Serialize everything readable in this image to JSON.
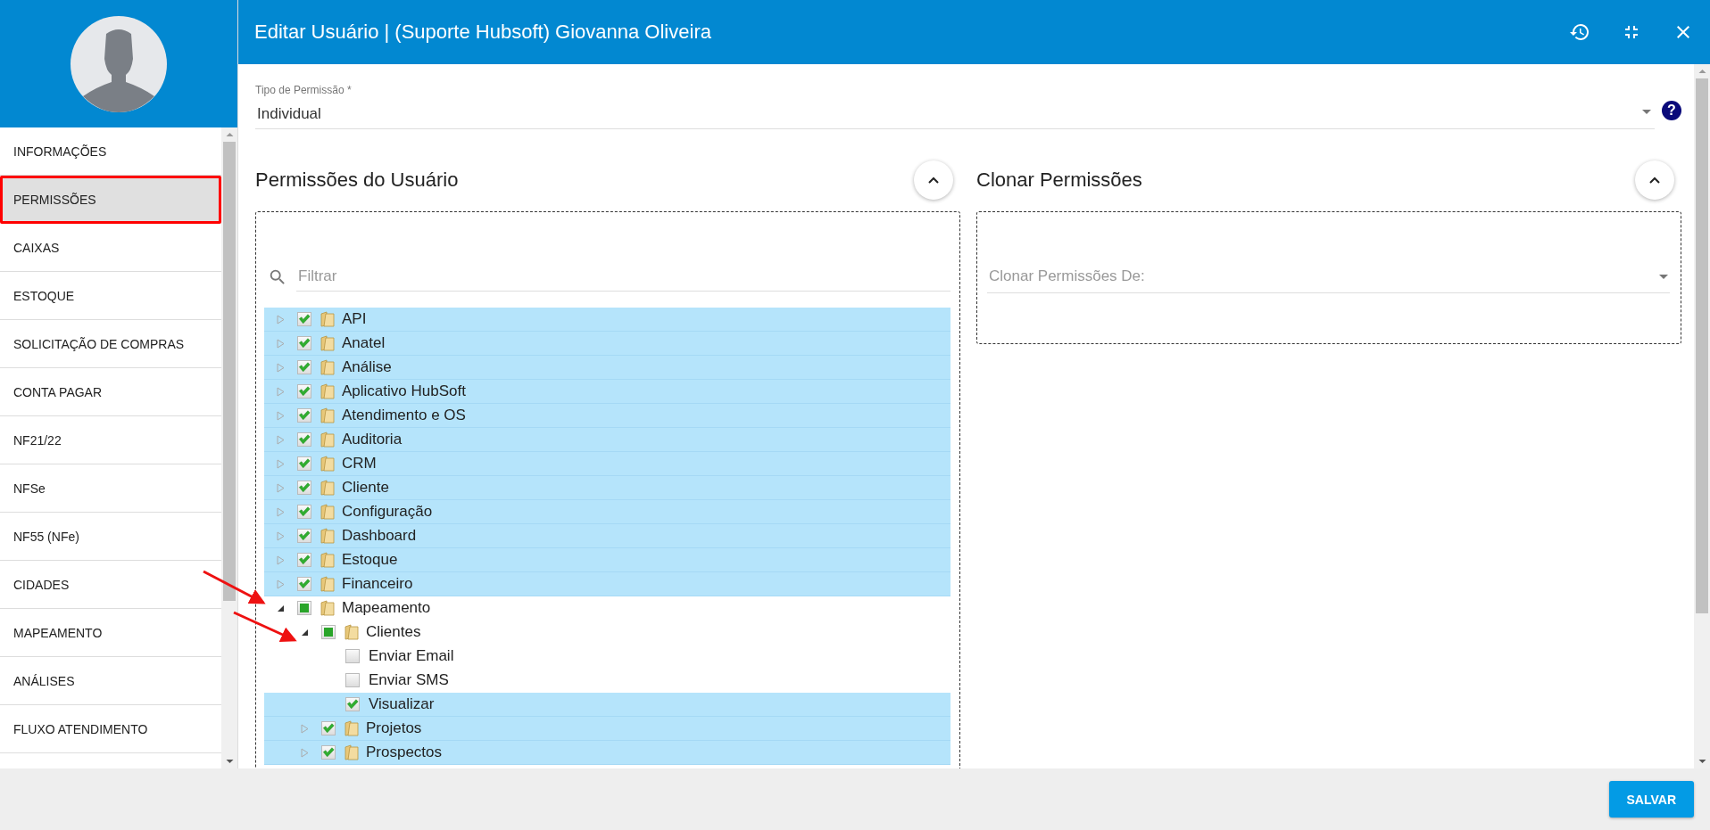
{
  "window": {
    "title": "Editar Usuário | (Suporte Hubsoft) Giovanna Oliveira"
  },
  "sidebar": {
    "items": [
      {
        "label": "INFORMAÇÕES",
        "selected": false,
        "framed": false
      },
      {
        "label": "PERMISSÕES",
        "selected": true,
        "framed": true
      },
      {
        "label": "CAIXAS",
        "selected": false,
        "framed": false
      },
      {
        "label": "ESTOQUE",
        "selected": false,
        "framed": false
      },
      {
        "label": "SOLICITAÇÃO DE COMPRAS",
        "selected": false,
        "framed": false
      },
      {
        "label": "CONTA PAGAR",
        "selected": false,
        "framed": false
      },
      {
        "label": "NF21/22",
        "selected": false,
        "framed": false
      },
      {
        "label": "NFSe",
        "selected": false,
        "framed": false
      },
      {
        "label": "NF55 (NFe)",
        "selected": false,
        "framed": false
      },
      {
        "label": "CIDADES",
        "selected": false,
        "framed": false
      },
      {
        "label": "MAPEAMENTO",
        "selected": false,
        "framed": false
      },
      {
        "label": "ANÁLISES",
        "selected": false,
        "framed": false
      },
      {
        "label": "FLUXO ATENDIMENTO",
        "selected": false,
        "framed": false
      }
    ]
  },
  "permission_type": {
    "label": "Tipo de Permissão *",
    "value": "Individual",
    "help_icon": "?"
  },
  "user_permissions": {
    "title": "Permissões do Usuário",
    "filter": {
      "placeholder": "Filtrar"
    },
    "tree": [
      {
        "kind": "folder",
        "label": "API",
        "checked": true,
        "partial": false,
        "expanded": false
      },
      {
        "kind": "folder",
        "label": "Anatel",
        "checked": true,
        "partial": false,
        "expanded": false
      },
      {
        "kind": "folder",
        "label": "Análise",
        "checked": true,
        "partial": false,
        "expanded": false
      },
      {
        "kind": "folder",
        "label": "Aplicativo HubSoft",
        "checked": true,
        "partial": false,
        "expanded": false
      },
      {
        "kind": "folder",
        "label": "Atendimento e OS",
        "checked": true,
        "partial": false,
        "expanded": false
      },
      {
        "kind": "folder",
        "label": "Auditoria",
        "checked": true,
        "partial": false,
        "expanded": false
      },
      {
        "kind": "folder",
        "label": "CRM",
        "checked": true,
        "partial": false,
        "expanded": false
      },
      {
        "kind": "folder",
        "label": "Cliente",
        "checked": true,
        "partial": false,
        "expanded": false
      },
      {
        "kind": "folder",
        "label": "Configuração",
        "checked": true,
        "partial": false,
        "expanded": false
      },
      {
        "kind": "folder",
        "label": "Dashboard",
        "checked": true,
        "partial": false,
        "expanded": false
      },
      {
        "kind": "folder",
        "label": "Estoque",
        "checked": true,
        "partial": false,
        "expanded": false
      },
      {
        "kind": "folder",
        "label": "Financeiro",
        "checked": true,
        "partial": false,
        "expanded": false
      },
      {
        "kind": "folder",
        "label": "Mapeamento",
        "checked": false,
        "partial": true,
        "expanded": true,
        "children": [
          {
            "kind": "folder",
            "label": "Clientes",
            "checked": false,
            "partial": true,
            "expanded": true,
            "children": [
              {
                "kind": "leaf",
                "label": "Enviar Email",
                "checked": false,
                "partial": false
              },
              {
                "kind": "leaf",
                "label": "Enviar SMS",
                "checked": false,
                "partial": false
              },
              {
                "kind": "leaf",
                "label": "Visualizar",
                "checked": true,
                "partial": false
              }
            ]
          },
          {
            "kind": "folder",
            "label": "Projetos",
            "checked": true,
            "partial": false,
            "expanded": false
          },
          {
            "kind": "folder",
            "label": "Prospectos",
            "checked": true,
            "partial": false,
            "expanded": false
          }
        ]
      }
    ]
  },
  "clone_permissions": {
    "title": "Clonar Permissões",
    "select": {
      "placeholder": "Clonar Permissões De:"
    }
  },
  "annotations": [
    {
      "kind": "arrow"
    },
    {
      "kind": "arrow"
    }
  ],
  "footer": {
    "save_button": "SALVAR"
  }
}
